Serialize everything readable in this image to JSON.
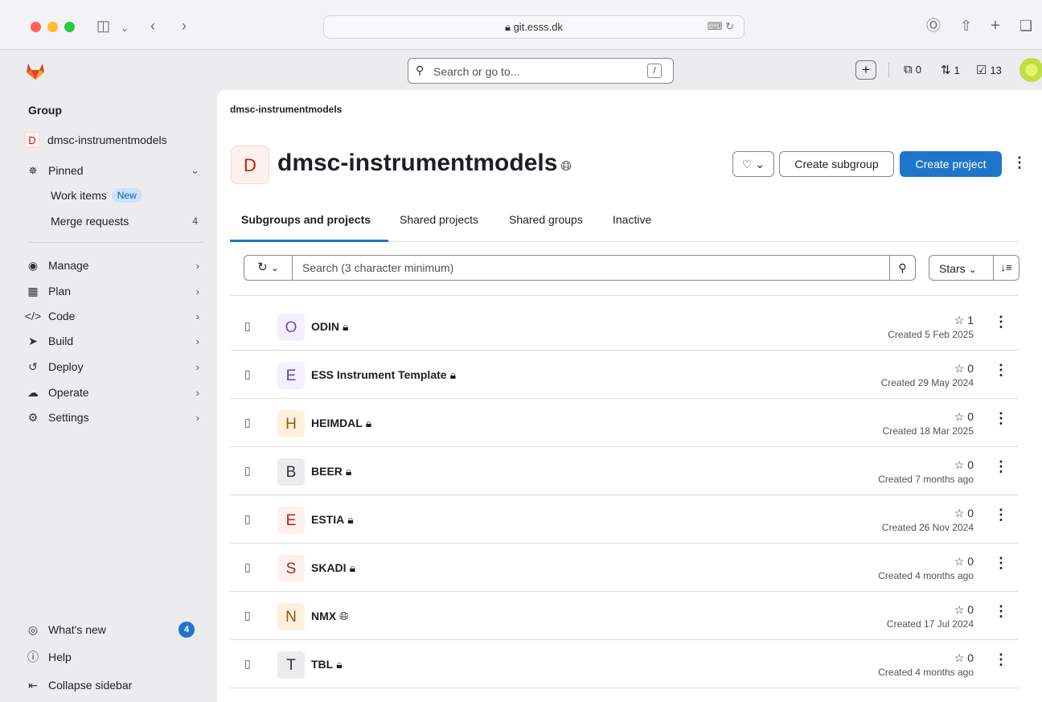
{
  "browser": {
    "url": "git.esss.dk"
  },
  "topbar": {
    "search_placeholder": "Search or go to...",
    "search_key": "/",
    "issues_count": "0",
    "merge_requests_count": "1",
    "todos_count": "13"
  },
  "sidebar": {
    "section_title": "Group",
    "group_initial": "D",
    "group_name": "dmsc-instrumentmodels",
    "pinned_label": "Pinned",
    "work_items_label": "Work items",
    "new_badge": "New",
    "merge_requests_label": "Merge requests",
    "merge_requests_count": "4",
    "nav": [
      {
        "label": "Manage",
        "icon": "users-icon"
      },
      {
        "label": "Plan",
        "icon": "calendar-icon"
      },
      {
        "label": "Code",
        "icon": "code-icon"
      },
      {
        "label": "Build",
        "icon": "rocket-icon"
      },
      {
        "label": "Deploy",
        "icon": "deploy-icon"
      },
      {
        "label": "Operate",
        "icon": "cloud-icon"
      },
      {
        "label": "Settings",
        "icon": "gear-icon"
      }
    ],
    "whats_new_label": "What's new",
    "whats_new_count": "4",
    "help_label": "Help",
    "collapse_label": "Collapse sidebar"
  },
  "main": {
    "breadcrumb": "dmsc-instrumentmodels",
    "group_initial": "D",
    "group_title": "dmsc-instrumentmodels",
    "create_subgroup_label": "Create subgroup",
    "create_project_label": "Create project",
    "tabs": [
      {
        "label": "Subgroups and projects",
        "active": true
      },
      {
        "label": "Shared projects",
        "active": false
      },
      {
        "label": "Shared groups",
        "active": false
      },
      {
        "label": "Inactive",
        "active": false
      }
    ],
    "search_placeholder": "Search (3 character minimum)",
    "sort_label": "Stars",
    "projects": [
      {
        "initial": "O",
        "name": "ODIN",
        "visibility": "private",
        "stars": "1",
        "created": "Created 5 Feb 2025",
        "color": "#6e49cb",
        "bg": "#f4f0ff"
      },
      {
        "initial": "E",
        "name": "ESS Instrument Template",
        "visibility": "private",
        "stars": "0",
        "created": "Created 29 May 2024",
        "color": "#5943b6",
        "bg": "#f4f0ff"
      },
      {
        "initial": "H",
        "name": "HEIMDAL",
        "visibility": "private",
        "stars": "0",
        "created": "Created 18 Mar 2025",
        "color": "#9e5400",
        "bg": "#fdf1dd"
      },
      {
        "initial": "B",
        "name": "BEER",
        "visibility": "private",
        "stars": "0",
        "created": "Created 7 months ago",
        "color": "#333238",
        "bg": "#ececef"
      },
      {
        "initial": "E",
        "name": "ESTIA",
        "visibility": "private",
        "stars": "0",
        "created": "Created 26 Nov 2024",
        "color": "#c91c00",
        "bg": "#fcf1ef"
      },
      {
        "initial": "S",
        "name": "SKADI",
        "visibility": "private",
        "stars": "0",
        "created": "Created 4 months ago",
        "color": "#a02e1c",
        "bg": "#fcf1ef"
      },
      {
        "initial": "N",
        "name": "NMX",
        "visibility": "public",
        "stars": "0",
        "created": "Created 17 Jul 2024",
        "color": "#9e5400",
        "bg": "#fdf1dd"
      },
      {
        "initial": "T",
        "name": "TBL",
        "visibility": "private",
        "stars": "0",
        "created": "Created 4 months ago",
        "color": "#333238",
        "bg": "#ececef"
      }
    ]
  }
}
